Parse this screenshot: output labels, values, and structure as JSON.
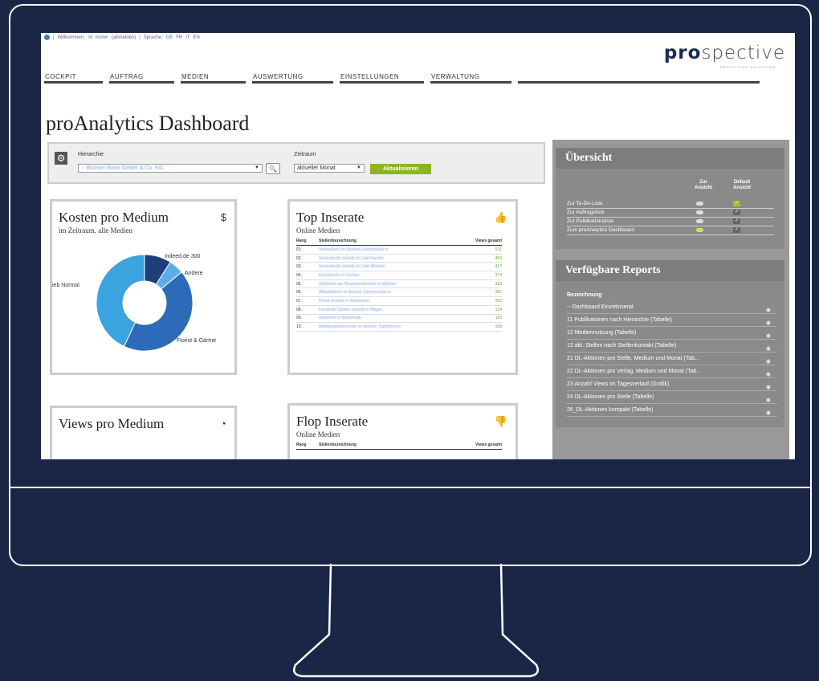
{
  "topbar": {
    "welcome": "Willkommen,",
    "user": "W. Müller",
    "logout": "(abmelden)",
    "sep": "|",
    "language_label": "Sprache:",
    "languages": [
      "DE",
      "FR",
      "IT",
      "EN"
    ]
  },
  "logo": {
    "brand_pro": "pro",
    "brand_rest": "spective",
    "tagline": "RECRUITING SOLUTIONS"
  },
  "nav": [
    "COCKPIT",
    "AUFTRAG",
    "MEDIEN",
    "AUSWERTUNG",
    "EINSTELLUNGEN",
    "VERWALTUNG"
  ],
  "page_title": "proAnalytics Dashboard",
  "filter": {
    "hierarchy_label": "Hierarchie",
    "hierarchy_value": "-- Blumen Rose GmbH & Co. KG",
    "period_label": "Zeitraum",
    "period_value": "aktueller Monat",
    "update_button": "Aktualisieren"
  },
  "kosten": {
    "title": "Kosten pro Medium",
    "subtitle": "im Zeitraum, alle Medien",
    "labels": {
      "indeed": "indeed.de 300",
      "andere": "Andere",
      "web": "ieb Normal",
      "florist": "Florist & Gärtne"
    },
    "chart_data": {
      "type": "pie",
      "categories": [
        "indeed.de",
        "Andere",
        "Florist & Gärtner",
        "Web Normal"
      ],
      "values": [
        9,
        5,
        43,
        43
      ],
      "colors": [
        "#1e3f7a",
        "#5aaee8",
        "#2d6ab8",
        "#3aa3e0"
      ]
    }
  },
  "top": {
    "title": "Top Inserate",
    "subtitle": "Online Medien",
    "col_rank": "Rang",
    "col_name": "Stellenbezeichnung",
    "col_views": "Views gesamt",
    "rows": [
      {
        "rank": "01.",
        "name": "Verkäufer/in im Blumen-Gartenmarkt m",
        "views": "511"
      },
      {
        "rank": "02.",
        "name": "Servicekraft (m/w/d) im Café Fischer",
        "views": "453"
      },
      {
        "rank": "03.",
        "name": "Servicekraft (m/w/d) im Café Münster",
        "views": "417"
      },
      {
        "rank": "04.",
        "name": "Kassierer/in in Fischen",
        "views": "374"
      },
      {
        "rank": "05.",
        "name": "Gärtner/in am Baumschulbetrieb in Münster",
        "views": "313"
      },
      {
        "rank": "06.",
        "name": "Mitarbeiter/in im Bereich Gartencenter in",
        "views": "287"
      },
      {
        "rank": "07.",
        "name": "Florist (m/w/d) in Riethausen",
        "views": "202"
      },
      {
        "rank": "08.",
        "name": "Fachkraft Gärtner (m/w/d) in Wagen",
        "views": "124"
      },
      {
        "rank": "09.",
        "name": "Gärtner/in in Buxtehude",
        "views": "115"
      },
      {
        "rank": "10.",
        "name": "Abteilungsleiter/innen im Bereich Topfpflanzen",
        "views": "108"
      }
    ]
  },
  "views": {
    "title": "Views pro Medium"
  },
  "flop": {
    "title": "Flop Inserate",
    "subtitle": "Online Medien",
    "col_rank": "Rang",
    "col_name": "Stellenbezeichnung",
    "col_views": "Views gesamt"
  },
  "overview": {
    "title": "Übersicht",
    "col_view": "Zur Ansicht",
    "col_default": "Default Ansicht",
    "rows": [
      {
        "label": "Zur To-Do-Liste",
        "default": true
      },
      {
        "label": "Zur Auftragsliste",
        "default": false
      },
      {
        "label": "Zur Publikationsliste",
        "default": false
      },
      {
        "label": "Zum proAnalytics Dashboard",
        "default": false
      }
    ]
  },
  "reports": {
    "title": "Verfügbare Reports",
    "col": "Bezeichnung",
    "rows": [
      "-- Dashboard Einzelinserat",
      "11 Publikationen nach Hierarchie (Tabelle)",
      "12 Mediennutzung (Tabelle)",
      "13 akt. Stellen nach Stellenkontakt (Tabelle)",
      "21 DL-Aktionen pro Stelle, Medium und Monat (Tab...",
      "22 DL-Aktionen pro Verlag, Medium und Monat (Tab...",
      "23 Anzahl Views im Tagesverlauf (Grafik)",
      "24 DL-Aktionen pro Stelle (Tabelle)",
      "26_DL-Aktionen kompakt (Tabelle)"
    ]
  }
}
